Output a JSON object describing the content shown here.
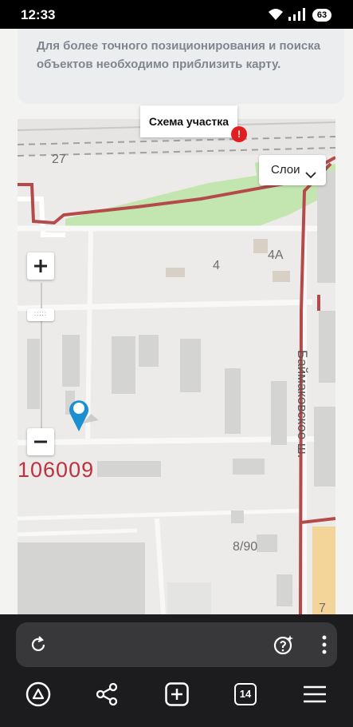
{
  "status_bar": {
    "time": "12:33",
    "battery": "63"
  },
  "info": {
    "message": "Для более точного позиционирования и поиска объектов необходимо приблизить карту."
  },
  "map": {
    "tooltip": "Схема участка",
    "alert_badge": "!",
    "layers_button": "Слои",
    "zoom_in": "+",
    "zoom_out": "−",
    "labels": {
      "house_27": "27",
      "house_4": "4",
      "house_4a": "4А",
      "house_8_90": "8/90",
      "house_7": "7"
    },
    "cadastral_number": "106009",
    "street_name": "Баймаковское ш.",
    "accent_color": "#c0303e"
  },
  "browser": {
    "tabs_count": "14"
  }
}
